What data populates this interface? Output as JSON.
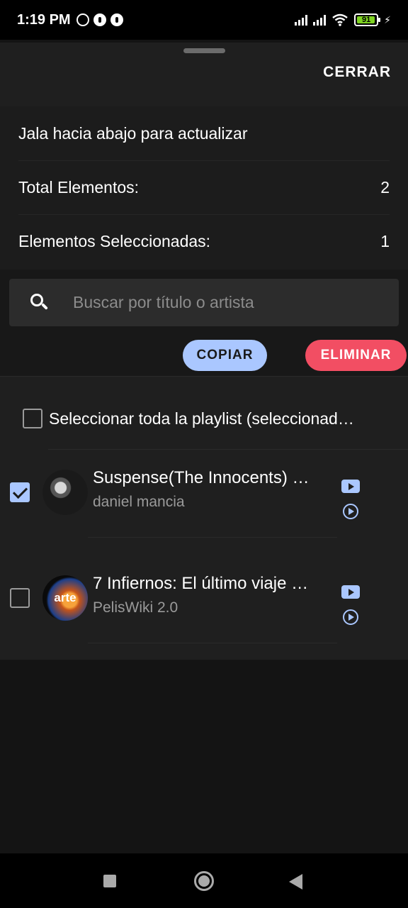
{
  "status_bar": {
    "time": "1:19 PM",
    "battery_level": "91",
    "icons": [
      "alarm-icon",
      "app-notification-icon",
      "app-notification-icon",
      "signal-icon",
      "signal-icon",
      "wifi-icon",
      "battery-icon",
      "charging-icon"
    ]
  },
  "sheet": {
    "close_label": "CERRAR",
    "refresh_hint": "Jala hacia abajo para actualizar",
    "total_label": "Total Elementos:",
    "total_value": "2",
    "selected_label": "Elementos Seleccionadas:",
    "selected_value": "1"
  },
  "search": {
    "placeholder": "Buscar por título o artista",
    "value": ""
  },
  "actions": {
    "copy_label": "COPIAR",
    "delete_label": "ELIMINAR"
  },
  "select_all": {
    "label": "Seleccionar toda la playlist (seleccionad…",
    "checked": false
  },
  "items": [
    {
      "title": "Suspense(The Innocents) …",
      "artist": "daniel mancia",
      "checked": true
    },
    {
      "title": "7 Infiernos: El último viaje …",
      "artist": "PelisWiki 2.0",
      "checked": false,
      "thumb_text": "arte"
    }
  ],
  "colors": {
    "accent": "#aac7ff",
    "danger": "#f24e63",
    "battery": "#7ed321"
  }
}
